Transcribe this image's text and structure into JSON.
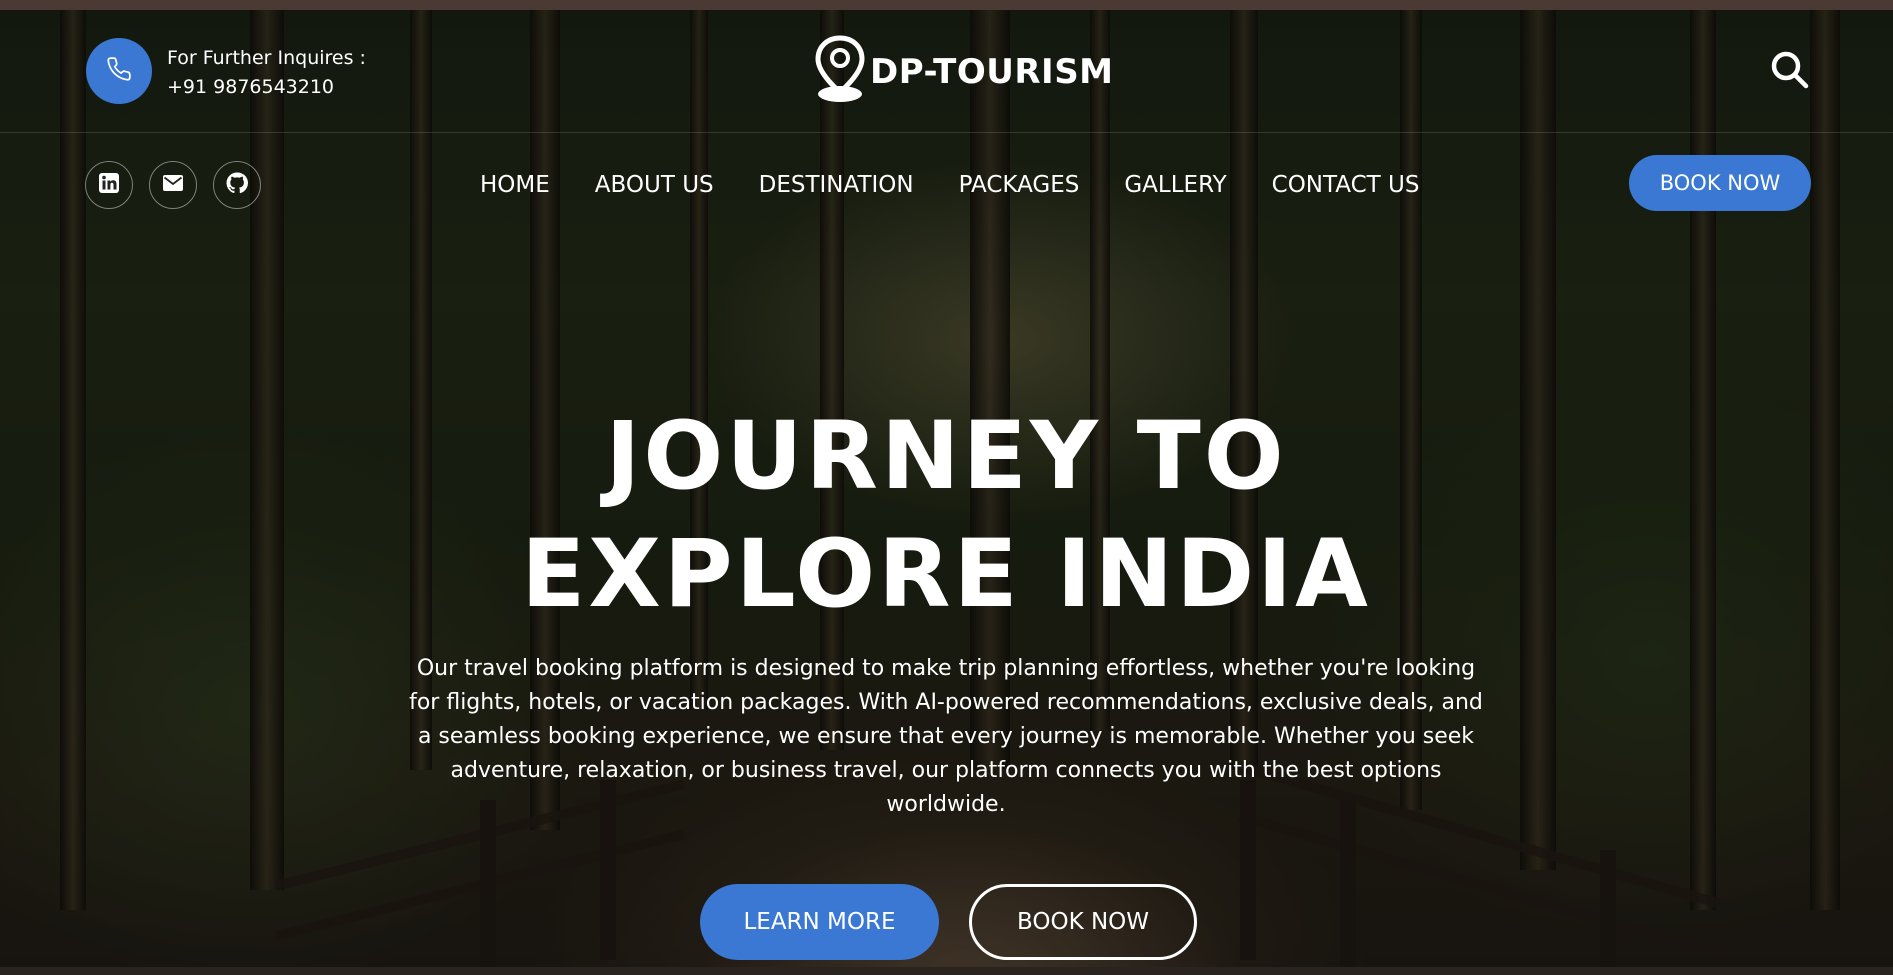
{
  "header": {
    "inquiry_label": "For Further Inquires :",
    "phone": "+91 9876543210",
    "logo_text": "DP-TOURISM"
  },
  "nav": {
    "items": [
      {
        "label": "HOME"
      },
      {
        "label": "ABOUT US"
      },
      {
        "label": "DESTINATION"
      },
      {
        "label": "PACKAGES"
      },
      {
        "label": "GALLERY"
      },
      {
        "label": "CONTACT US"
      }
    ],
    "book_label": "BOOK NOW"
  },
  "social": [
    "linkedin-icon",
    "mail-icon",
    "github-icon"
  ],
  "hero": {
    "title_line1": "JOURNEY TO",
    "title_line2": "EXPLORE INDIA",
    "description": "Our travel booking platform is designed to make trip planning effortless, whether you're looking for flights, hotels, or vacation packages. With AI-powered recommendations, exclusive deals, and a seamless booking experience, we ensure that every journey is memorable. Whether you seek adventure, relaxation, or business travel, our platform connects you with the best options worldwide.",
    "learn_more_label": "LEARN MORE",
    "book_now_label": "BOOK NOW"
  },
  "colors": {
    "accent": "#3a78d4",
    "text": "#ffffff"
  }
}
